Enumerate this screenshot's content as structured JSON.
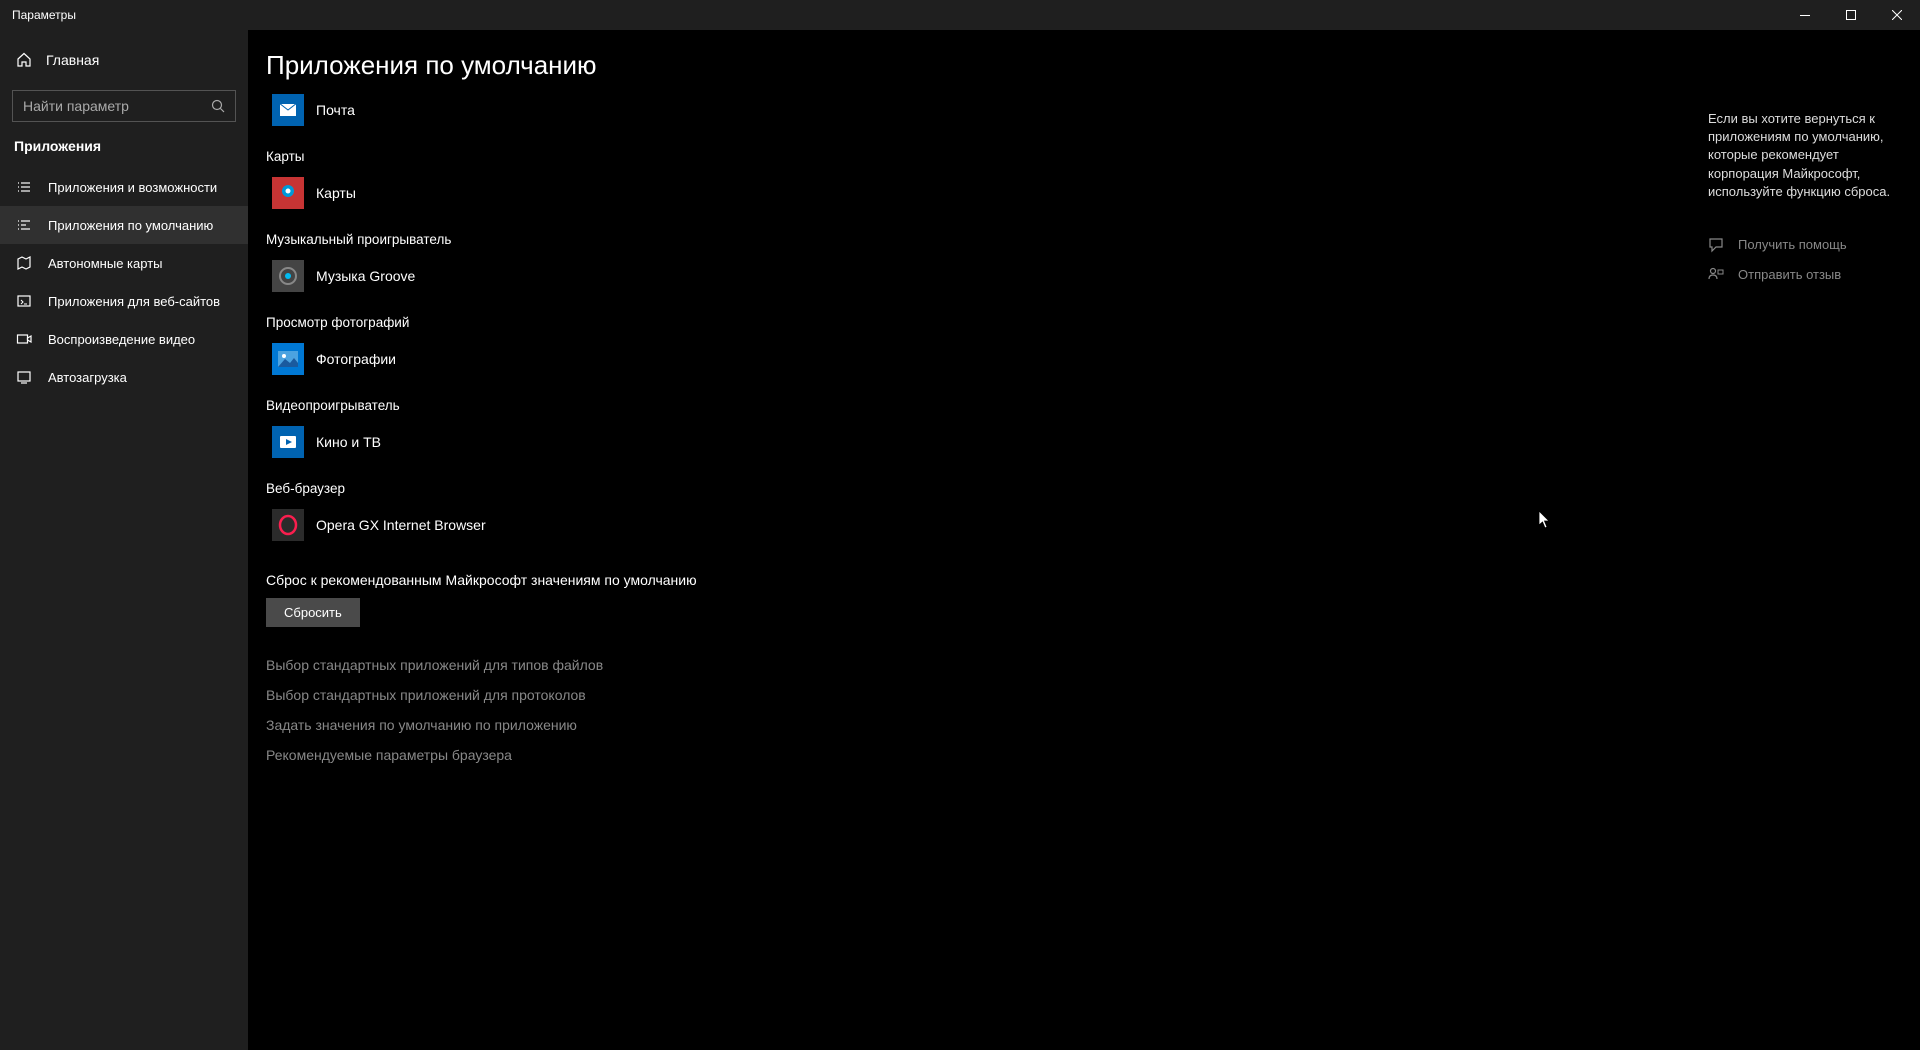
{
  "titlebar": {
    "title": "Параметры"
  },
  "sidebar": {
    "home": "Главная",
    "search_placeholder": "Найти параметр",
    "header": "Приложения",
    "items": [
      {
        "label": "Приложения и возможности"
      },
      {
        "label": "Приложения по умолчанию"
      },
      {
        "label": "Автономные карты"
      },
      {
        "label": "Приложения для веб-сайтов"
      },
      {
        "label": "Воспроизведение видео"
      },
      {
        "label": "Автозагрузка"
      }
    ]
  },
  "main": {
    "title": "Приложения по умолчанию",
    "categories": [
      {
        "label": "",
        "app": "Почта",
        "icon_bg": "#0063b1",
        "icon_fg": "#fff"
      },
      {
        "label": "Карты",
        "app": "Карты",
        "icon_bg": "#c73434",
        "icon_fg": "#00bcf2"
      },
      {
        "label": "Музыкальный проигрыватель",
        "app": "Музыка Groove",
        "icon_bg": "#444",
        "icon_fg": "#00bcf2"
      },
      {
        "label": "Просмотр фотографий",
        "app": "Фотографии",
        "icon_bg": "#0078d4",
        "icon_fg": "#fff"
      },
      {
        "label": "Видеопроигрыватель",
        "app": "Кино и ТВ",
        "icon_bg": "#0063b1",
        "icon_fg": "#fff"
      },
      {
        "label": "Веб-браузер",
        "app": "Opera GX Internet Browser",
        "icon_bg": "#2b2b2b",
        "icon_fg": "#fa1e4e"
      }
    ],
    "reset_label": "Сброс к рекомендованным Майкрософт значениям по умолчанию",
    "reset_button": "Сбросить",
    "links": [
      "Выбор стандартных приложений для типов файлов",
      "Выбор стандартных приложений для протоколов",
      "Задать значения по умолчанию по приложению",
      "Рекомендуемые параметры браузера"
    ]
  },
  "right": {
    "info": "Если вы хотите вернуться к приложениям по умолчанию, которые рекомендует корпорация Майкрософт, используйте функцию сброса.",
    "help": "Получить помощь",
    "feedback": "Отправить отзыв"
  }
}
